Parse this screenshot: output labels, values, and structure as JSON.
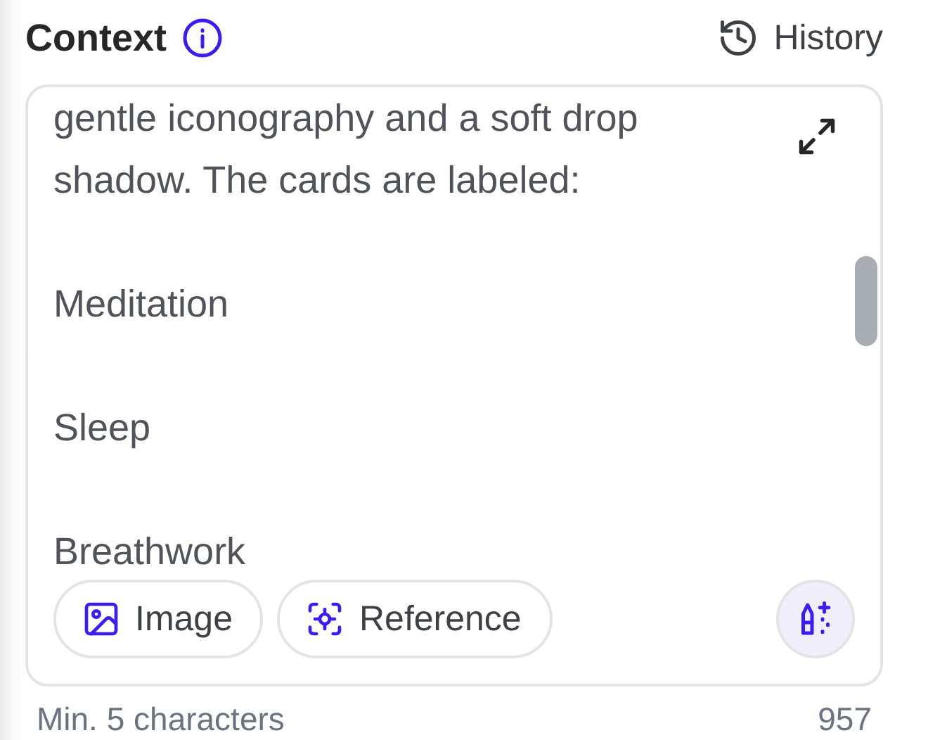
{
  "header": {
    "title": "Context",
    "history_label": "History"
  },
  "context": {
    "paragraphs": [
      "gentle iconography and a soft drop shadow. The cards are labeled:",
      "Meditation",
      "Sleep",
      "Breathwork"
    ]
  },
  "attachments": [
    {
      "kind": "image",
      "label": "Image"
    },
    {
      "kind": "reference",
      "label": "Reference"
    }
  ],
  "footer": {
    "hint": "Min. 5 characters",
    "count": "957"
  }
}
